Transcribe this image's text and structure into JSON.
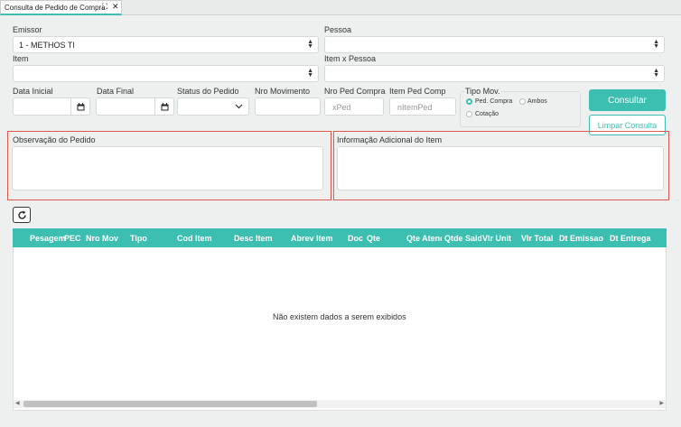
{
  "tab": {
    "title": "Consulta de Pedido de Compra"
  },
  "filters": {
    "emissor": {
      "label": "Emissor",
      "value": "1 - METHOS TI"
    },
    "pessoa": {
      "label": "Pessoa",
      "value": ""
    },
    "item": {
      "label": "Item",
      "value": ""
    },
    "item_pessoa": {
      "label": "Item x Pessoa",
      "value": ""
    },
    "data_inicial": {
      "label": "Data Inicial",
      "value": ""
    },
    "data_final": {
      "label": "Data Final",
      "value": ""
    },
    "status_pedido": {
      "label": "Status do Pedido",
      "value": ""
    },
    "nro_movimento": {
      "label": "Nro Movimento",
      "value": ""
    },
    "nro_ped_compra": {
      "label": "Nro Ped Compra",
      "placeholder": "xPed"
    },
    "item_ped_comp": {
      "label": "Item Ped Comp",
      "placeholder": "nItemPed"
    }
  },
  "tipo_mov": {
    "legend": "Tipo Mov.",
    "options": [
      "Ped. Compra",
      "Ambos",
      "Cotação"
    ],
    "selected": "Ped. Compra"
  },
  "buttons": {
    "consultar": "Consultar",
    "limpar": "Limpar Consulta"
  },
  "observacao": {
    "label": "Observação do Pedido",
    "value": ""
  },
  "info_adicional": {
    "label": "Informação Adicional do Item",
    "value": ""
  },
  "grid": {
    "columns": [
      "Pesagem",
      "PEC",
      "Nro Mov",
      "Tipo",
      "Cod Item",
      "Desc Item",
      "Abrev Item",
      "Doc",
      "Qte",
      "Qte Atend",
      "Qtde Saldo",
      "Vlr Unit",
      "Vlr Total",
      "Dt Emissao",
      "Dt Entrega"
    ],
    "empty_message": "Não existem dados a serem exibidos"
  },
  "colors": {
    "accent": "#3cbfb1",
    "highlight_border": "#e0574f"
  },
  "icons": [
    "expand-icon",
    "close-icon",
    "calendar-icon",
    "chevron-down-icon",
    "refresh-icon"
  ]
}
